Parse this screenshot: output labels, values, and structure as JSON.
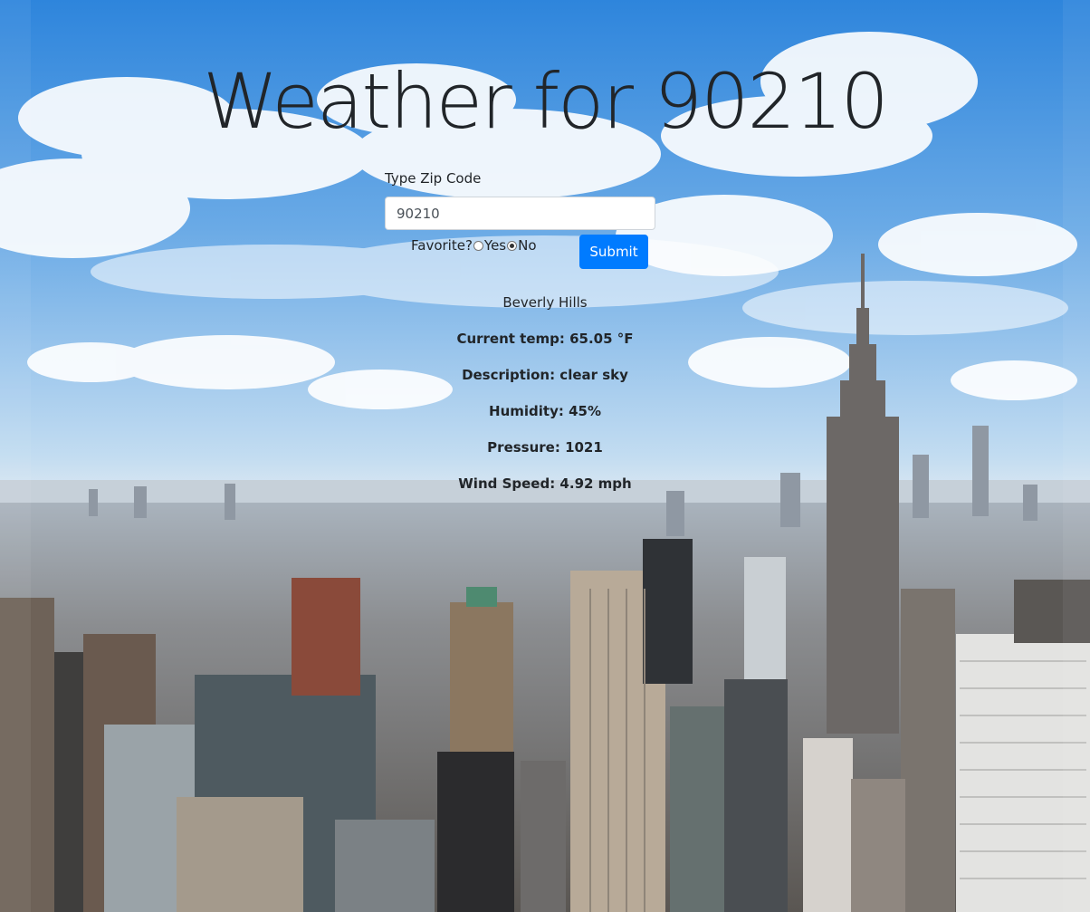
{
  "header": {
    "title": "Weather for 90210"
  },
  "form": {
    "zip_label": "Type Zip Code",
    "zip_value": "90210",
    "favorite_label": "Favorite?",
    "favorite_options": [
      {
        "label": "Yes",
        "checked": false
      },
      {
        "label": "No",
        "checked": true
      }
    ],
    "submit_label": "Submit"
  },
  "results": {
    "city": "Beverly Hills",
    "stats": [
      "Current temp: 65.05 °F",
      "Description: clear sky",
      "Humidity: 45%",
      "Pressure: 1021",
      "Wind Speed: 4.92 mph"
    ]
  },
  "colors": {
    "sky_top": "#2f86dd",
    "sky_mid": "#8cc0ee",
    "haze": "#dfe9f2",
    "button": "#007bff"
  }
}
